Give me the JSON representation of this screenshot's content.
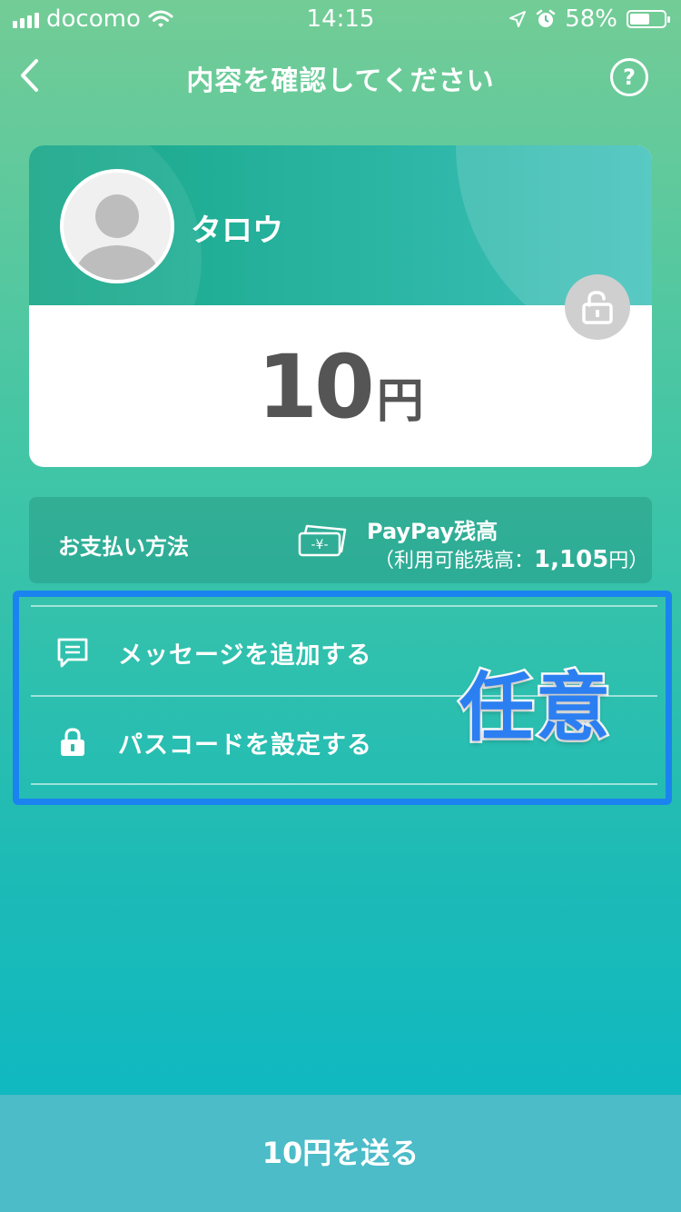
{
  "status_bar": {
    "carrier": "docomo",
    "time": "14:15",
    "battery_percent": "58%",
    "battery_level": 0.58
  },
  "header": {
    "title": "内容を確認してください",
    "help_label": "?"
  },
  "recipient": {
    "name": "タロウ"
  },
  "amount": {
    "value": "10",
    "unit": "円"
  },
  "payment": {
    "label": "お支払い方法",
    "method_name": "PayPay残高",
    "balance_prefix": "（利用可能残高：",
    "balance_value": "1,105",
    "balance_suffix": "円）"
  },
  "options": {
    "items": [
      {
        "label": "メッセージを追加する",
        "icon": "message-icon"
      },
      {
        "label": "パスコードを設定する",
        "icon": "lock-icon"
      }
    ],
    "annotation": "任意"
  },
  "send_button": {
    "label": "10円を送る"
  },
  "colors": {
    "accent": "#1b83f0",
    "send_button": "#4bbcc8",
    "card_top": "#18a788"
  }
}
